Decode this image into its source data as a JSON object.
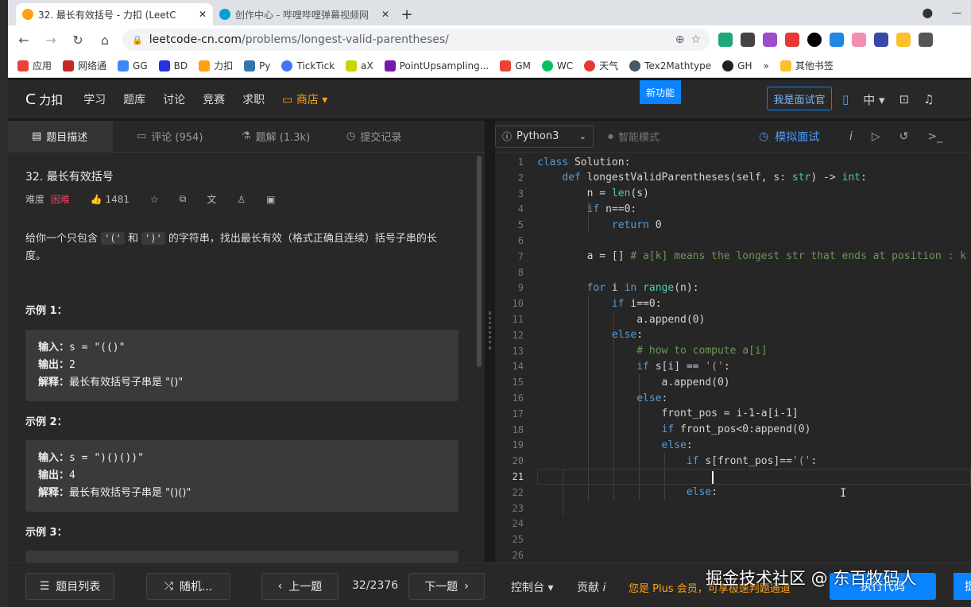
{
  "browser": {
    "tabs": [
      {
        "title": "32. 最长有效括号 - 力扣 (LeetC",
        "close": "✕"
      },
      {
        "title": "创作中心 - 哔哩哔哩弹幕视频网",
        "close": "✕"
      }
    ],
    "new_tab": "+",
    "url_domain": "leetcode-cn.com",
    "url_path": "/problems/longest-valid-parentheses/",
    "bookmarks": [
      "应用",
      "网络通",
      "GG",
      "BD",
      "力扣",
      "Py",
      "TickTick",
      "aX",
      "PointUpsampling...",
      "GM",
      "WC",
      "天气",
      "Tex2Mathtype",
      "GH"
    ],
    "bookmarks_overflow": "»",
    "other_bookmarks": "其他书签"
  },
  "lc_nav": {
    "logo": "力扣",
    "links": [
      "学习",
      "题库",
      "讨论",
      "竞赛",
      "求职"
    ],
    "shop": "商店",
    "new_feature": "新功能",
    "interviewer": "我是面试官",
    "lang": "中"
  },
  "left": {
    "tabs": [
      "题目描述",
      "评论 (954)",
      "题解 (1.3k)",
      "提交记录"
    ],
    "title": "32. 最长有效括号",
    "difficulty_label": "难度",
    "difficulty": "困难",
    "likes": "1481",
    "desc_pre": "给你一个只包含 ",
    "desc_code1": "'('",
    "desc_mid": " 和 ",
    "desc_code2": "')'",
    "desc_post": " 的字符串，找出最长有效（格式正确且连续）括号子串的长度。",
    "examples": [
      {
        "title": "示例 1：",
        "input_label": "输入：",
        "input": "s = \"(()\"",
        "output_label": "输出：",
        "output": "2",
        "explain_label": "解释：",
        "explain": "最长有效括号子串是 \"()\""
      },
      {
        "title": "示例 2：",
        "input_label": "输入：",
        "input": "s = \")()())\"",
        "output_label": "输出：",
        "output": "4",
        "explain_label": "解释：",
        "explain": "最长有效括号子串是 \"()()\""
      },
      {
        "title": "示例 3："
      }
    ]
  },
  "editor": {
    "language": "Python3",
    "smart_mode": "智能模式",
    "mock_test": "模拟面试",
    "cursor_line": "21",
    "code_lines": [
      "class Solution:",
      "    def longestValidParentheses(self, s: str) -> int:",
      "        n = len(s)",
      "        if n==0:",
      "            return 0",
      "",
      "        a = [] # a[k] means the longest str that ends at position : k",
      "",
      "        for i in range(n):",
      "            if i==0:",
      "                a.append(0)",
      "            else:",
      "                # how to compute a[i]",
      "                if s[i] == '(':",
      "                    a.append(0)",
      "                else:",
      "                    front_pos = i-1-a[i-1]",
      "                    if front_pos<0:append(0)",
      "                    else:",
      "                        if s[front_pos]=='(':",
      "                            ",
      "                        else:",
      "",
      "",
      "",
      ""
    ]
  },
  "bottom": {
    "problem_list": "题目列表",
    "random": "随机...",
    "prev": "上一题",
    "pager": "32/2376",
    "next": "下一题",
    "console": "控制台",
    "contribute": "贡献",
    "plus_msg": "您是 Plus 会员，可享极速判题通道",
    "run": "执行代码",
    "submit": "提"
  },
  "watermark": "掘金技术社区 @ 东百牧码人",
  "colors": {
    "accent": "#0a84ff",
    "difficulty_hard": "#ff375f",
    "shop": "#ffa116"
  }
}
